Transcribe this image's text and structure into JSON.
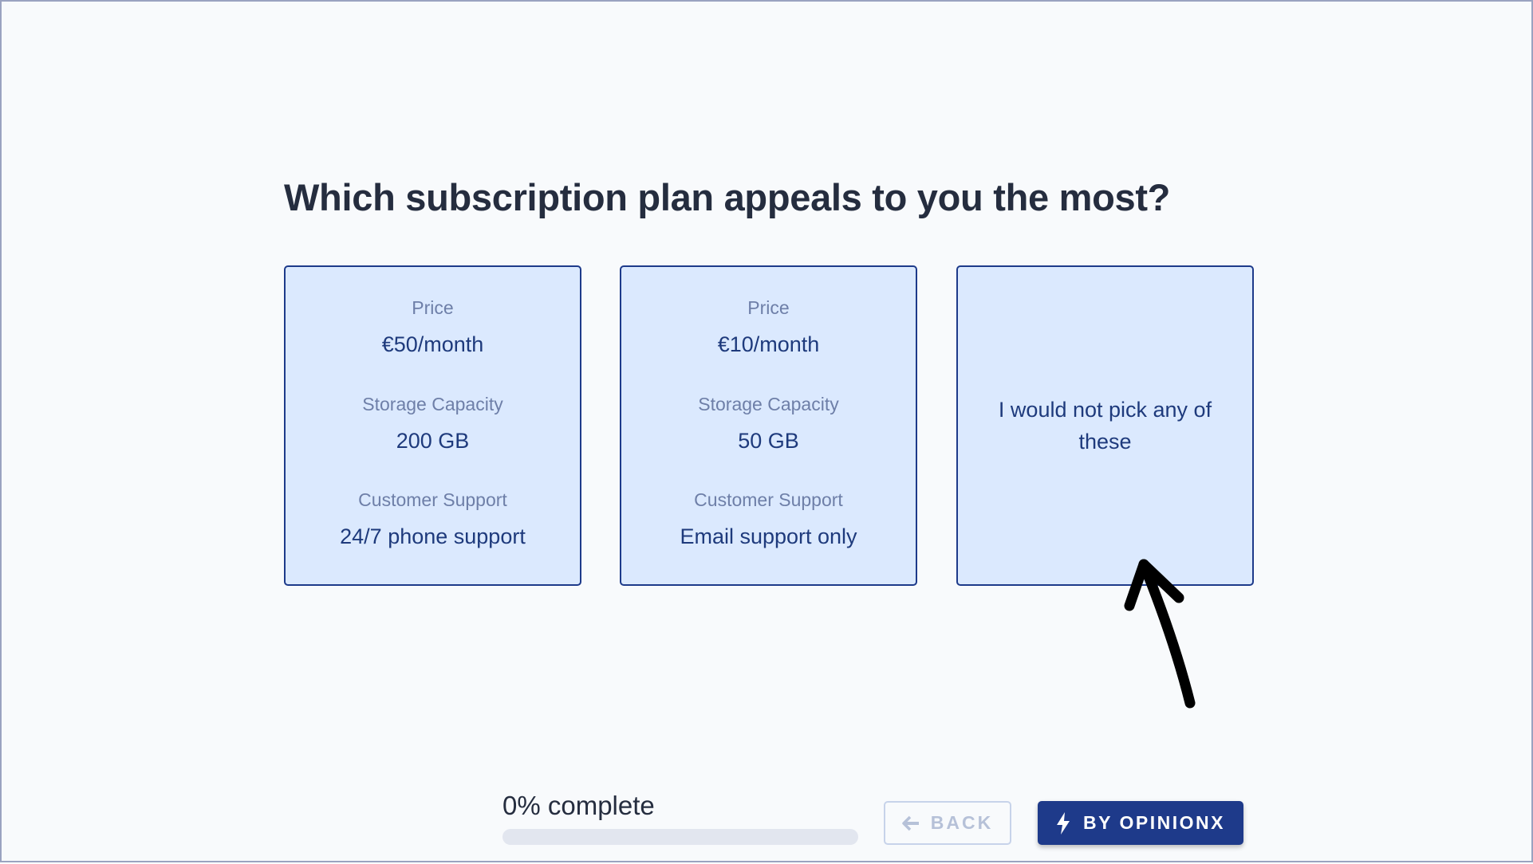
{
  "question": "Which subscription plan appeals to you the most?",
  "options": [
    {
      "attributes": [
        {
          "label": "Price",
          "value": "€50/month"
        },
        {
          "label": "Storage Capacity",
          "value": "200 GB"
        },
        {
          "label": "Customer Support",
          "value": "24/7 phone support"
        }
      ]
    },
    {
      "attributes": [
        {
          "label": "Price",
          "value": "€10/month"
        },
        {
          "label": "Storage Capacity",
          "value": "50 GB"
        },
        {
          "label": "Customer Support",
          "value": "Email support only"
        }
      ]
    }
  ],
  "none_option": "I would not pick any of these",
  "progress": {
    "label": "0% complete",
    "percent": 0
  },
  "footer": {
    "back_label": "BACK",
    "brand_label": "BY OPINIONX"
  },
  "icons": {
    "back": "arrow-left-icon",
    "brand": "lightning-bolt-icon",
    "annotation": "hand-drawn-arrow-icon"
  },
  "colors": {
    "accent": "#1e3a8a",
    "card_bg": "#dbe9fe",
    "page_bg": "#f8fafc"
  }
}
